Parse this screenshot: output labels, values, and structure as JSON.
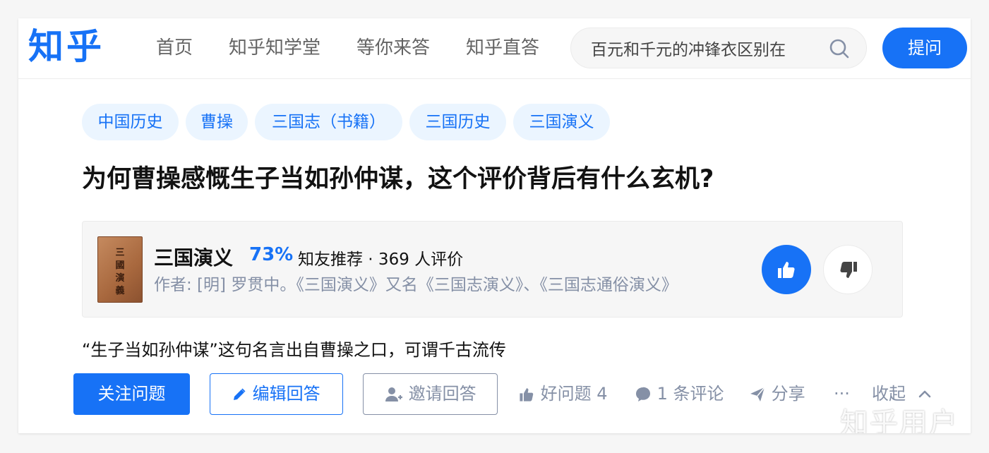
{
  "header": {
    "logo": "知乎",
    "nav": [
      "首页",
      "知乎知学堂",
      "等你来答",
      "知乎直答"
    ],
    "search_value": "百元和千元的冲锋衣区别在",
    "ask_label": "提问"
  },
  "question": {
    "tags": [
      "中国历史",
      "曹操",
      "三国志（书籍）",
      "三国历史",
      "三国演义"
    ],
    "title": "为何曹操感慨生子当如孙仲谋，这个评价背后有什么玄机?",
    "excerpt": "“生子当如孙仲谋”这句名言出自曹操之口，可谓千古流传"
  },
  "book": {
    "cover_text": "三國演義",
    "name": "三国演义",
    "score": "73%",
    "recommend": "知友推荐 · 369 人评价",
    "desc": "作者: [明] 罗贯中。《三国演义》又名《三国志演义》、《三国志通俗演义》"
  },
  "actions": {
    "follow": "关注问题",
    "edit": "编辑回答",
    "invite": "邀请回答",
    "good": "好问题 4",
    "comment": "1 条评论",
    "share": "分享",
    "more": "···",
    "collapse": "收起"
  },
  "watermark": "知乎用户",
  "colors": {
    "brand": "#1772f6",
    "tag_bg": "#ebf5ff",
    "muted": "#8590a6",
    "page_bg": "#f6f6f6"
  }
}
